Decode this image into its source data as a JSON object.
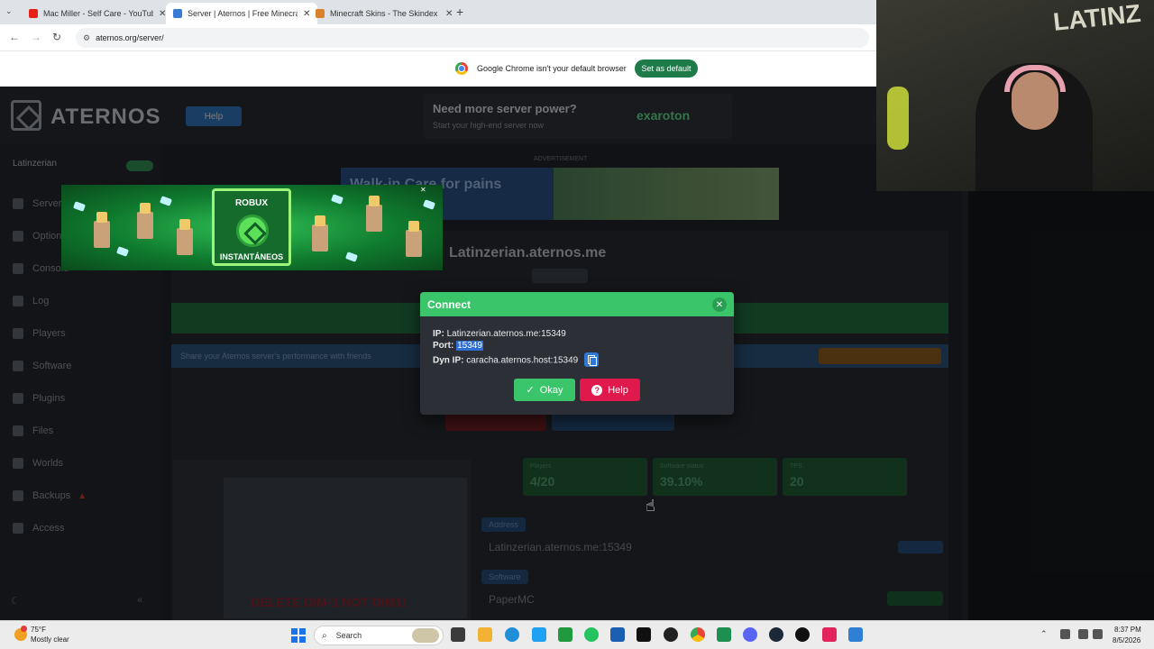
{
  "browser": {
    "tabs": [
      {
        "title": "Mac Miller - Self Care - YouTube",
        "favicon_color": "#e62117",
        "active": false
      },
      {
        "title": "Server | Aternos | Free Minecraft",
        "favicon_color": "#3a7bd5",
        "active": true
      },
      {
        "title": "Minecraft Skins - The Skindex",
        "favicon_color": "#d9822b",
        "active": false
      }
    ],
    "new_tab": "+",
    "url": "aternos.org/server/",
    "infobar": {
      "message": "Google Chrome isn't your default browser",
      "button": "Set as default"
    }
  },
  "site": {
    "logo": "ATERNOS",
    "help": "Help",
    "promo": {
      "title": "Need more server power?",
      "subtitle": "Start your high-end server now",
      "brand": "exaroton"
    },
    "sidebar": {
      "server_name": "Latinzerian",
      "items": [
        "Server",
        "Options",
        "Console",
        "Log",
        "Players",
        "Software",
        "Plugins",
        "Files",
        "Worlds",
        "Backups",
        "Access"
      ]
    },
    "ad_label": "ADVERTISEMENT",
    "ad_banner_text": "Walk-in Care for pains",
    "server_address": "Latinzerian.aternos.me",
    "info_text": "Share your Aternos server's performance with friends",
    "stats": [
      {
        "label": "Players",
        "value": "4/20"
      },
      {
        "label": "Software status",
        "value": "39.10%"
      },
      {
        "label": "TPS",
        "value": "20"
      }
    ],
    "address_label": "Address",
    "address_value": "Latinzerian.aternos.me:15349",
    "software_label": "Software",
    "software_value": "PaperMC",
    "thumb_warning": "DELETE DIM-1 NOT DIM1!"
  },
  "roblox_ad": {
    "title": "ROBUX",
    "subtitle": "INSTANTÁNEOS"
  },
  "modal": {
    "title": "Connect",
    "ip_label": "IP:",
    "ip_value": "Latinzerian.aternos.me:15349",
    "port_label": "Port:",
    "port_value": "15349",
    "dyn_label": "Dyn IP:",
    "dyn_value": "caracha.aternos.host:15349",
    "okay": "Okay",
    "help": "Help"
  },
  "webcam": {
    "graffiti": "LATINZ"
  },
  "taskbar": {
    "weather_temp": "75°F",
    "weather_desc": "Mostly clear",
    "search": "Search",
    "time": "8:37 PM",
    "date": "8/5/2026"
  },
  "colors": {
    "aternos_green": "#3ac56a",
    "help_red": "#e0194d",
    "copy_blue": "#2f78d6"
  }
}
